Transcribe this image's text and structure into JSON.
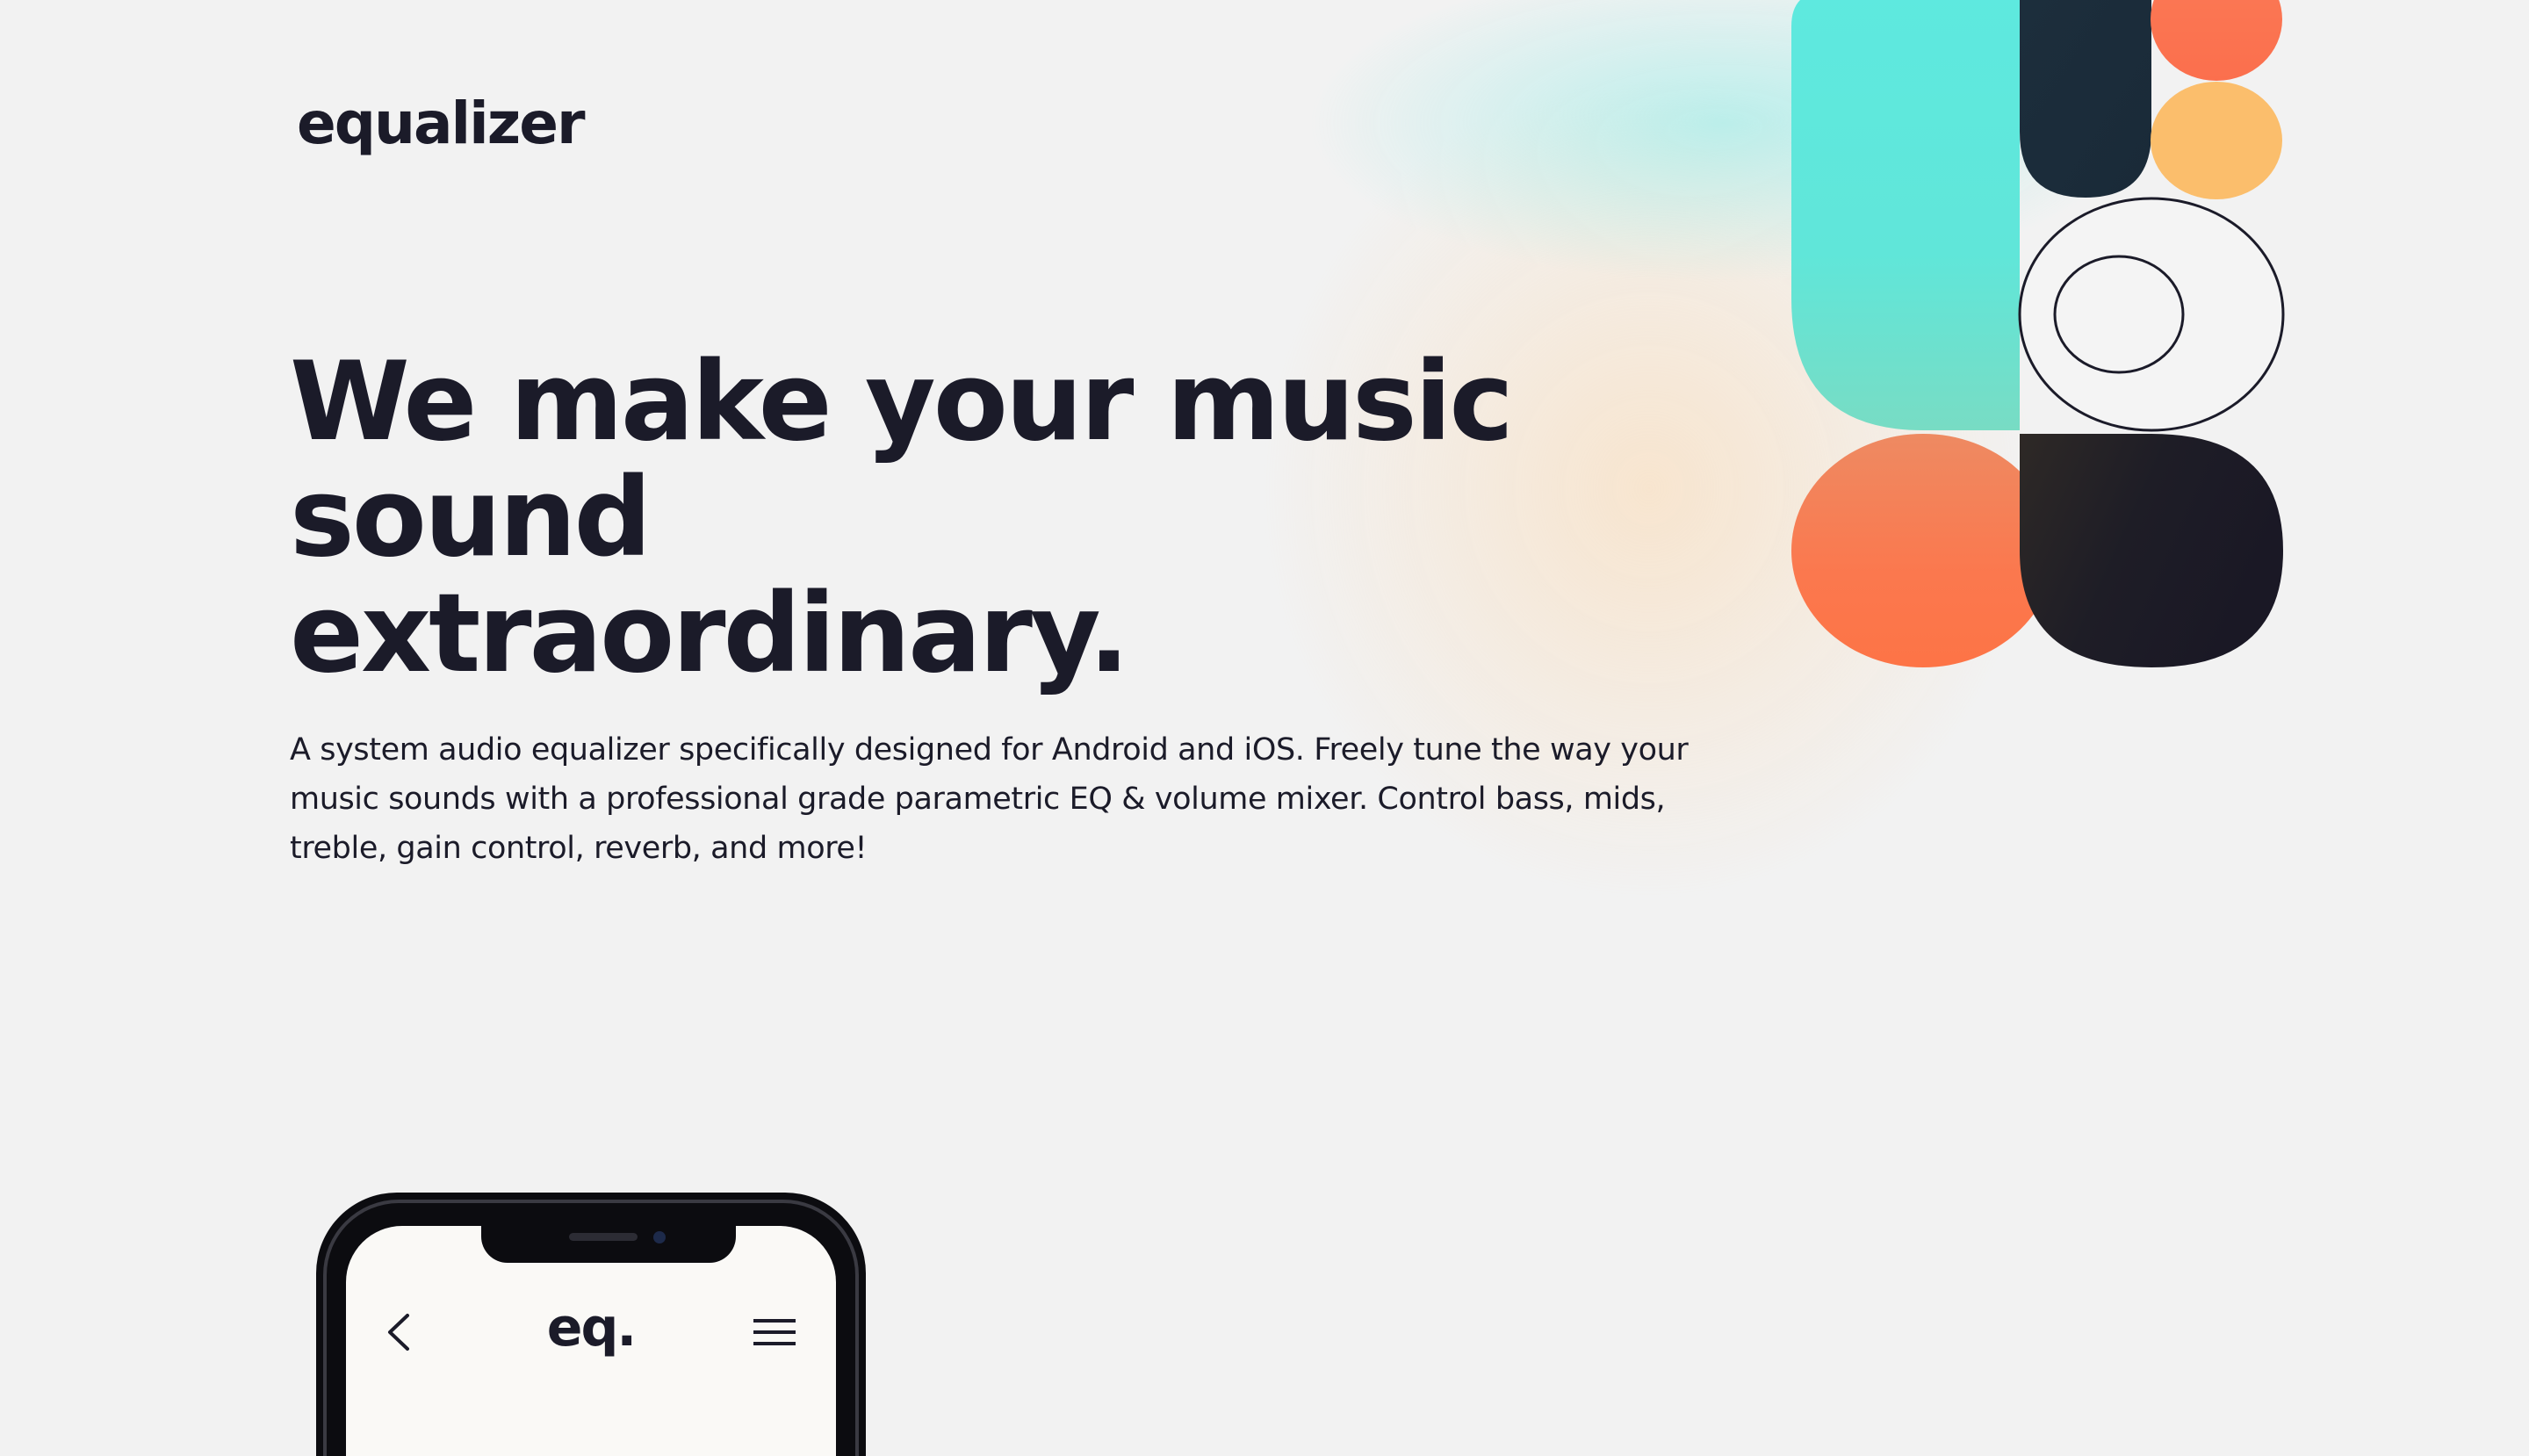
{
  "brand": {
    "logo_text": "equalizer"
  },
  "hero": {
    "headline_line1": "We make your music sound",
    "headline_line2": "extraordinary.",
    "description": "A system audio equalizer specifically designed for Android and iOS. Freely tune the way your music sounds with a professional grade parametric EQ & volume mixer. Control bass, mids, treble, gain control, reverb, and more!"
  },
  "phone": {
    "app_logo": "eq.",
    "icons": {
      "back": "chevron-left-icon",
      "menu": "hamburger-menu-icon"
    }
  },
  "colors": {
    "background": "#f2f2f2",
    "ink": "#1b1b29",
    "teal": "#5ce8df",
    "coral": "#fb7350",
    "amber": "#fbbf6b",
    "navy": "#1f2a36"
  }
}
